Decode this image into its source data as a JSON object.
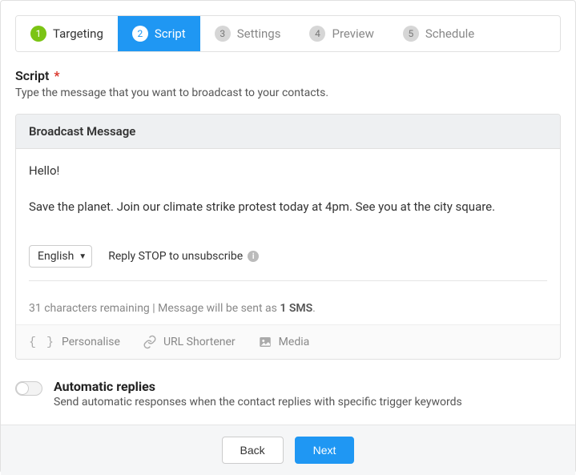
{
  "tabs": [
    {
      "num": "1",
      "label": "Targeting",
      "state": "done"
    },
    {
      "num": "2",
      "label": "Script",
      "state": "active"
    },
    {
      "num": "3",
      "label": "Settings",
      "state": "upcoming"
    },
    {
      "num": "4",
      "label": "Preview",
      "state": "upcoming"
    },
    {
      "num": "5",
      "label": "Schedule",
      "state": "upcoming"
    }
  ],
  "section": {
    "title": "Script",
    "required_mark": "*",
    "subtitle": "Type the message that you want to broadcast to your contacts."
  },
  "card": {
    "header": "Broadcast Message",
    "message": "Hello!\n\nSave the planet. Join our climate strike protest today at 4pm. See you at the city square.",
    "language": "English",
    "unsubscribe_hint": "Reply STOP to unsubscribe",
    "remaining_prefix": "31 characters remaining | Message will be sent as ",
    "sms_count": "1 SMS",
    "remaining_suffix": "."
  },
  "tools": {
    "personalise": "Personalise",
    "url_shortener": "URL Shortener",
    "media": "Media"
  },
  "auto": {
    "title": "Automatic replies",
    "desc": "Send automatic responses when the contact replies with specific trigger keywords"
  },
  "buttons": {
    "back": "Back",
    "next": "Next"
  }
}
